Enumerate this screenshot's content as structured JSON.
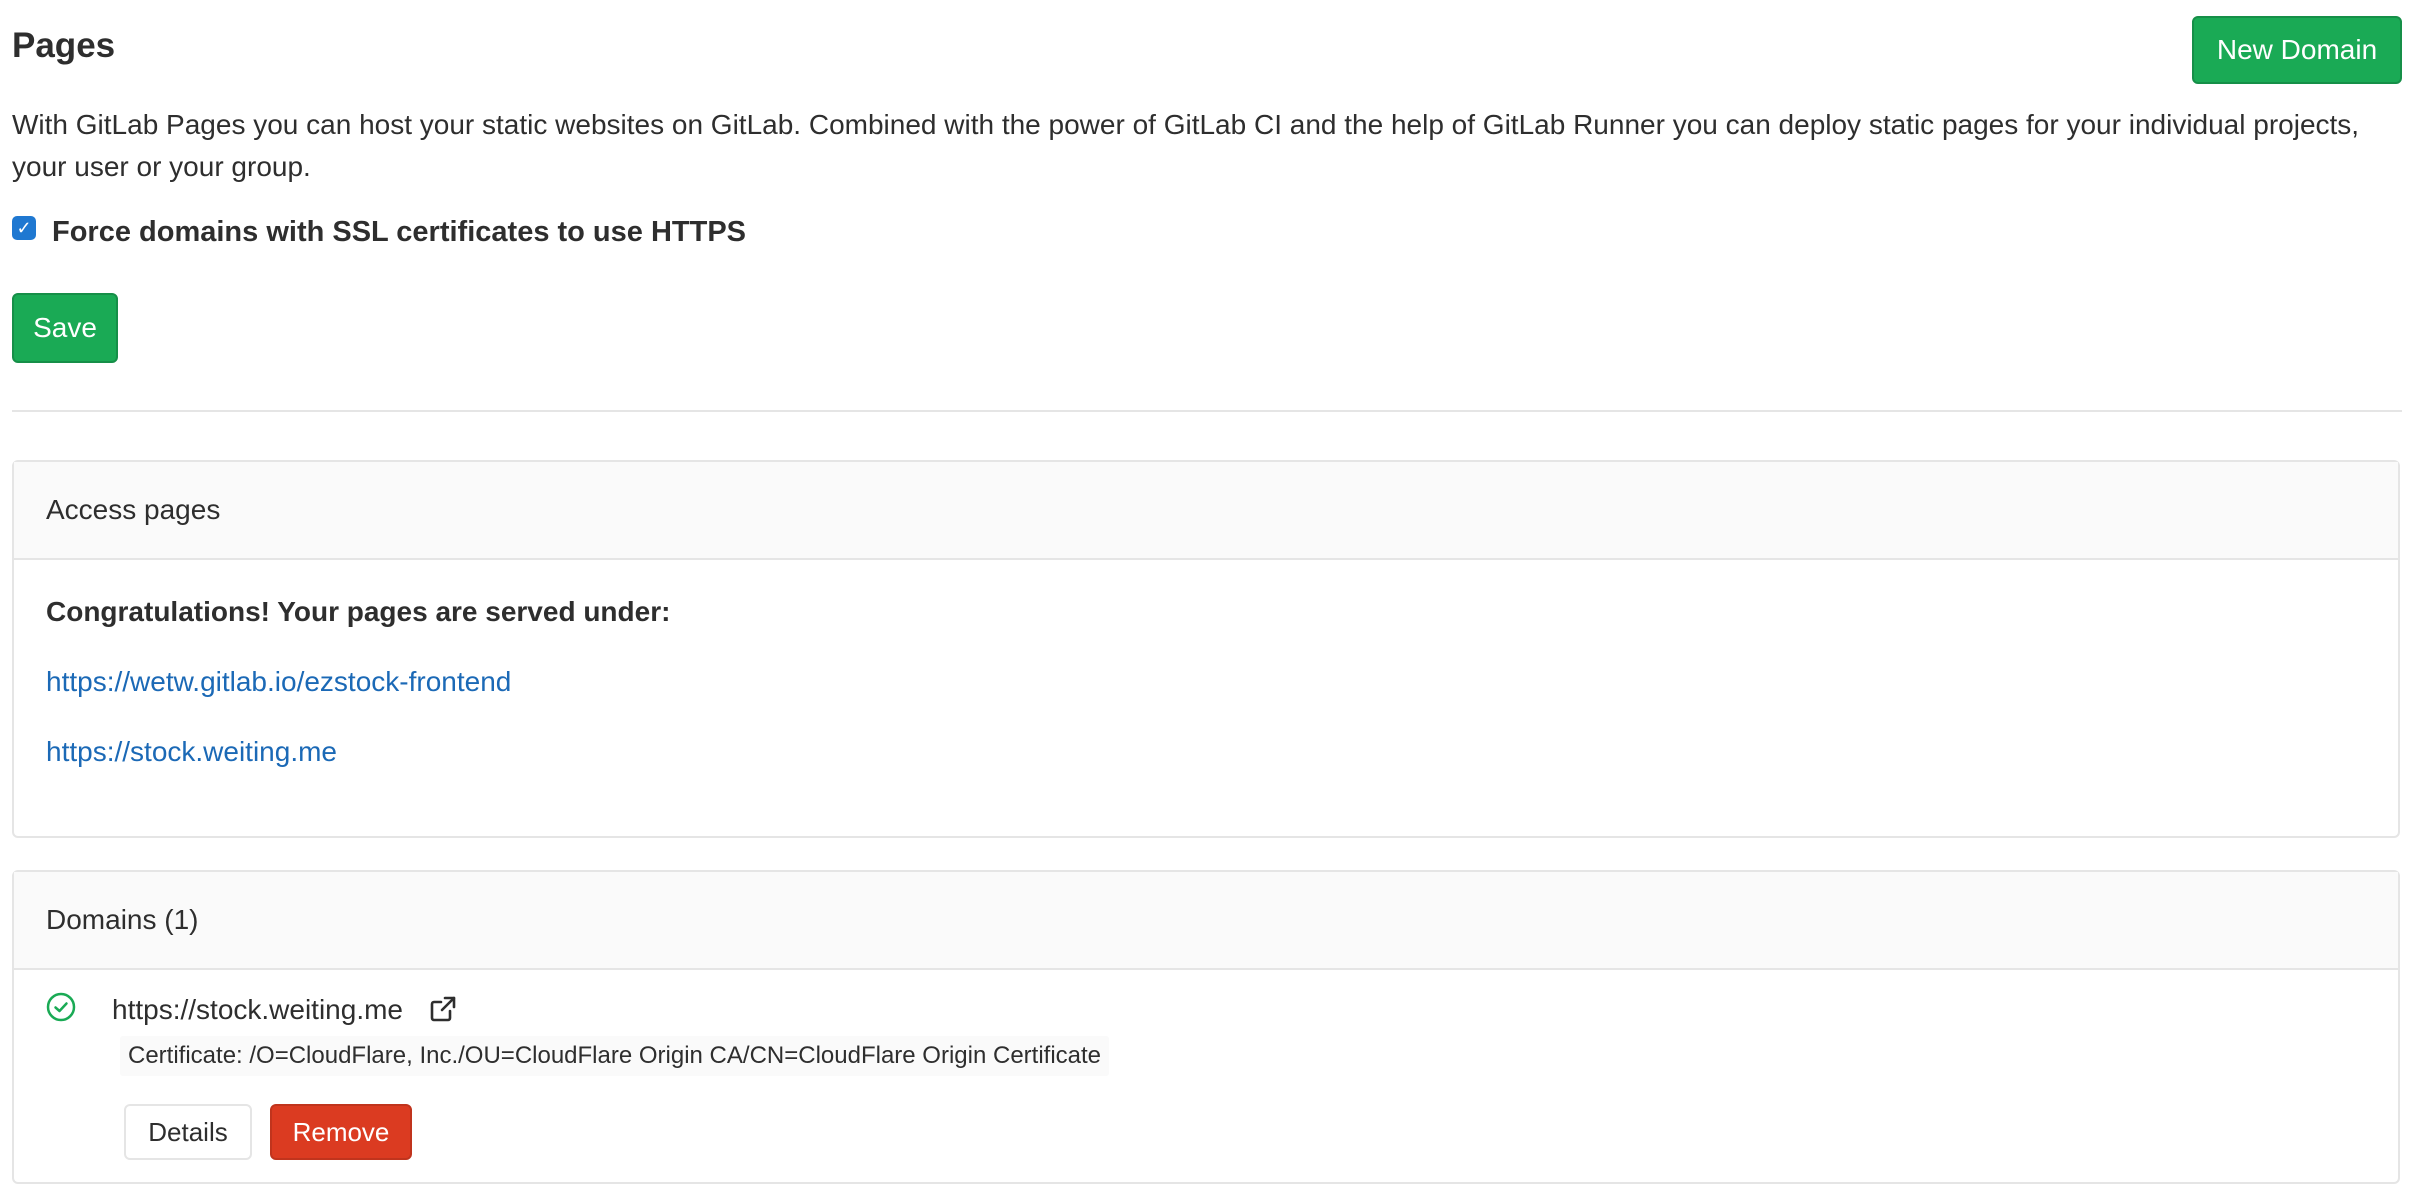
{
  "header": {
    "title": "Pages",
    "new_domain_label": "New Domain"
  },
  "intro": {
    "text": "With GitLab Pages you can host your static websites on GitLab. Combined with the power of GitLab CI and the help of GitLab Runner you can deploy static pages for your individual projects, your user or your group."
  },
  "https_setting": {
    "label": "Force domains with SSL certificates to use HTTPS",
    "checked": true,
    "save_label": "Save"
  },
  "access_pages": {
    "header": "Access pages",
    "congrats": "Congratulations! Your pages are served under:",
    "links": [
      "https://wetw.gitlab.io/ezstock-frontend",
      "https://stock.weiting.me"
    ]
  },
  "domains": {
    "header": "Domains (1)",
    "items": [
      {
        "name": "https://stock.weiting.me",
        "certificate": "Certificate: /O=CloudFlare, Inc./OU=CloudFlare Origin CA/CN=CloudFlare Origin Certificate",
        "status": "verified",
        "details_label": "Details",
        "remove_label": "Remove"
      }
    ]
  },
  "colors": {
    "success": "#1aaa55",
    "danger": "#db3b21",
    "link": "#1b69b6",
    "checkbox": "#1f78d1"
  },
  "icons": {
    "checkbox": "checkmark-icon",
    "status": "check-circle-icon",
    "external": "external-link-icon"
  }
}
